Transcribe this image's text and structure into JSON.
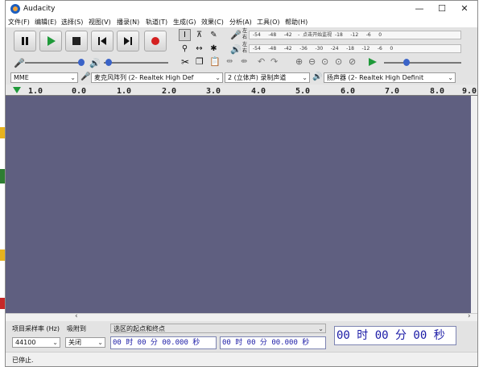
{
  "window": {
    "title": "Audacity",
    "minimize": "—",
    "maximize": "☐",
    "close": "✕"
  },
  "menu": [
    "文件(F)",
    "编辑(E)",
    "选择(S)",
    "视图(V)",
    "播录(N)",
    "轨道(T)",
    "生成(G)",
    "效果(C)",
    "分析(A)",
    "工具(O)",
    "帮助(H)"
  ],
  "meters": {
    "record": {
      "left_label": "左",
      "right_label": "右",
      "scale": [
        "-54",
        "-48",
        "-42",
        "-",
        "点击开始监视",
        "-18",
        "-12",
        "-6",
        "0"
      ]
    },
    "play": {
      "left_label": "左",
      "right_label": "右",
      "scale": [
        "-54",
        "-48",
        "-42",
        "-36",
        "-30",
        "-24",
        "-18",
        "-12",
        "-6",
        "0"
      ]
    }
  },
  "devices": {
    "host": "MME",
    "input": "麦克风阵列 (2- Realtek High Def",
    "channels": "2 (立体声) 录制声道",
    "output": "扬声器 (2- Realtek High Definit"
  },
  "ruler": [
    "1.0",
    "0.0",
    "1.0",
    "2.0",
    "3.0",
    "4.0",
    "5.0",
    "6.0",
    "7.0",
    "8.0",
    "9.0"
  ],
  "selection": {
    "rate_label": "项目采样率 (Hz)",
    "snap_label": "吸附到",
    "range_label": "选区的起点和终点",
    "rate_value": "44100",
    "snap_value": "关闭",
    "start": "00 时 00 分 00.000 秒",
    "end": "00 时 00 分 00.000 秒",
    "position": "00 时 00 分 00 秒"
  },
  "status": "已停止."
}
